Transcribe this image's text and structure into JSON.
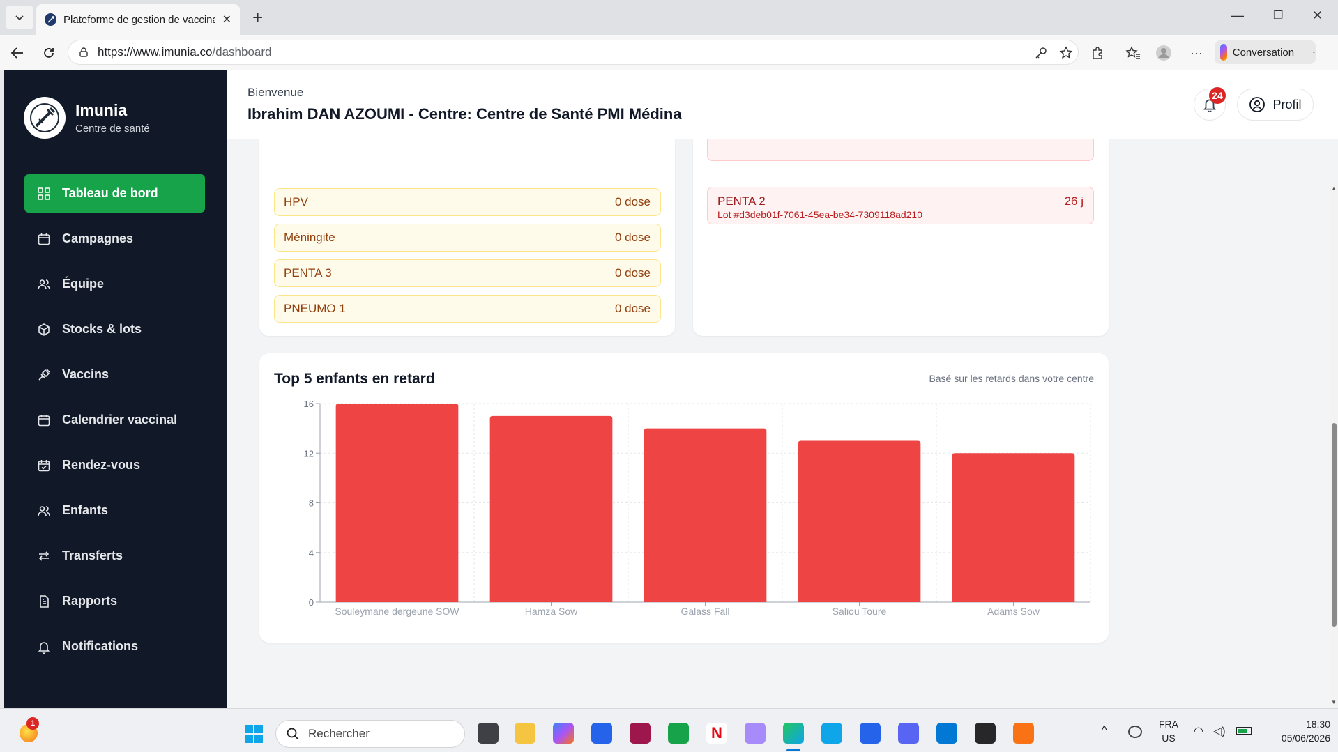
{
  "browser": {
    "tab_title": "Plateforme de gestion de vaccinati",
    "url_host": "https://www.imunia.co",
    "url_path": "/dashboard",
    "conversation_label": "Conversation"
  },
  "brand": {
    "name": "Imunia",
    "subtitle": "Centre de santé"
  },
  "sidebar": {
    "items": [
      {
        "label": "Tableau de bord",
        "icon": "grid-icon",
        "active": true
      },
      {
        "label": "Campagnes",
        "icon": "calendar-icon"
      },
      {
        "label": "Équipe",
        "icon": "users-icon"
      },
      {
        "label": "Stocks & lots",
        "icon": "package-icon"
      },
      {
        "label": "Vaccins",
        "icon": "syringe-icon"
      },
      {
        "label": "Calendrier vaccinal",
        "icon": "calendar-icon"
      },
      {
        "label": "Rendez-vous",
        "icon": "calendar-check-icon"
      },
      {
        "label": "Enfants",
        "icon": "users-icon"
      },
      {
        "label": "Transferts",
        "icon": "arrows-icon"
      },
      {
        "label": "Rapports",
        "icon": "document-icon"
      },
      {
        "label": "Notifications",
        "icon": "bell-icon"
      }
    ]
  },
  "header": {
    "welcome": "Bienvenue",
    "user_line": "Ibrahim DAN AZOUMI - Centre: Centre de Santé PMI Médina",
    "notification_count": "24",
    "profile_label": "Profil"
  },
  "low_stock": [
    {
      "name": "HPV",
      "qty": "0 dose"
    },
    {
      "name": "Méningite",
      "qty": "0 dose"
    },
    {
      "name": "PENTA 3",
      "qty": "0 dose"
    },
    {
      "name": "PNEUMO 1",
      "qty": "0 dose"
    }
  ],
  "expiring": [
    {
      "name": "PENTA 2",
      "lot": "Lot #d3deb01f-7061-45ea-be34-7309118ad210",
      "days": "26 j"
    }
  ],
  "chart_section": {
    "title": "Top 5 enfants en retard",
    "note": "Basé sur les retards dans votre centre"
  },
  "chart_data": {
    "type": "bar",
    "categories": [
      "Souleymane dergeune SOW",
      "Hamza Sow",
      "Galass Fall",
      "Saliou Toure",
      "Adams Sow"
    ],
    "values": [
      16,
      15,
      14,
      13,
      12
    ],
    "ylim": [
      0,
      16
    ],
    "yticks": [
      0,
      4,
      8,
      12,
      16
    ],
    "grid": true,
    "bar_color": "#ef4444"
  },
  "taskbar": {
    "search_placeholder": "Rechercher",
    "lang_top": "FRA",
    "lang_bottom": "US",
    "time": "18:30",
    "date": "05/06/2026",
    "weather_badge": "1"
  },
  "colors": {
    "sidebar_bg": "#111827",
    "accent_green": "#16a34a",
    "alert_red": "#dc2626"
  }
}
